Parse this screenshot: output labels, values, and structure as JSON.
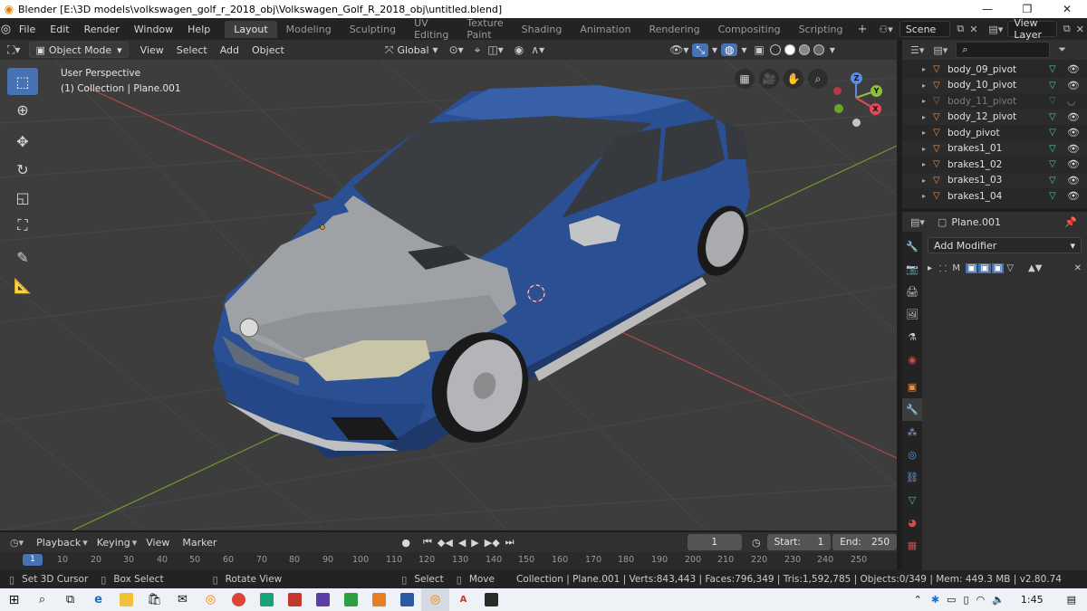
{
  "window": {
    "title": "Blender [E:\\3D models\\volkswagen_golf_r_2018_obj\\Volkswagen_Golf_R_2018_obj\\untitled.blend]",
    "minimize": "—",
    "maximize": "❐",
    "close": "✕"
  },
  "menubar": {
    "items": [
      "File",
      "Edit",
      "Render",
      "Window",
      "Help"
    ],
    "workspaces": [
      "Layout",
      "Modeling",
      "Sculpting",
      "UV Editing",
      "Texture Paint",
      "Shading",
      "Animation",
      "Rendering",
      "Compositing",
      "Scripting"
    ],
    "active_workspace": "Layout",
    "scene": "Scene",
    "view_layer": "View Layer"
  },
  "viewport_header": {
    "mode": "Object Mode",
    "menus": [
      "View",
      "Select",
      "Add",
      "Object"
    ],
    "orientation": "Global"
  },
  "viewport": {
    "perspective_label": "User Perspective",
    "collection_label": "(1) Collection | Plane.001",
    "gizmo_axes": [
      "Z",
      "Y",
      "X"
    ]
  },
  "outliner": {
    "rows": [
      {
        "name": "body_09_pivot",
        "dim": false
      },
      {
        "name": "body_10_pivot",
        "dim": false
      },
      {
        "name": "body_11_pivot",
        "dim": true
      },
      {
        "name": "body_12_pivot",
        "dim": false
      },
      {
        "name": "body_pivot",
        "dim": false
      },
      {
        "name": "brakes1_01",
        "dim": false
      },
      {
        "name": "brakes1_02",
        "dim": false
      },
      {
        "name": "brakes1_03",
        "dim": false
      },
      {
        "name": "brakes1_04",
        "dim": false
      }
    ]
  },
  "properties": {
    "object": "Plane.001",
    "add_modifier": "Add Modifier",
    "modifier_label": "M"
  },
  "timeline": {
    "menus": [
      "Playback",
      "Keying",
      "View",
      "Marker"
    ],
    "current_frame": "1",
    "start_label": "Start:",
    "start": "1",
    "end_label": "End:",
    "end": "250",
    "ticks": [
      "1",
      "10",
      "20",
      "30",
      "40",
      "50",
      "60",
      "70",
      "80",
      "90",
      "100",
      "110",
      "120",
      "130",
      "140",
      "150",
      "160",
      "170",
      "180",
      "190",
      "200",
      "210",
      "220",
      "230",
      "240",
      "250"
    ]
  },
  "statusbar": {
    "set_cursor": "Set 3D Cursor",
    "box_select": "Box Select",
    "rotate_view": "Rotate View",
    "select": "Select",
    "move": "Move",
    "stats": "Collection | Plane.001 | Verts:843,443 | Faces:796,349 | Tris:1,592,785 | Objects:0/349 | Mem: 449.3 MB | v2.80.74"
  },
  "taskbar": {
    "time": "1:45"
  },
  "colors": {
    "accent": "#4772b3",
    "car_body": "#2a4f93",
    "hood": "#9ea2a6"
  }
}
